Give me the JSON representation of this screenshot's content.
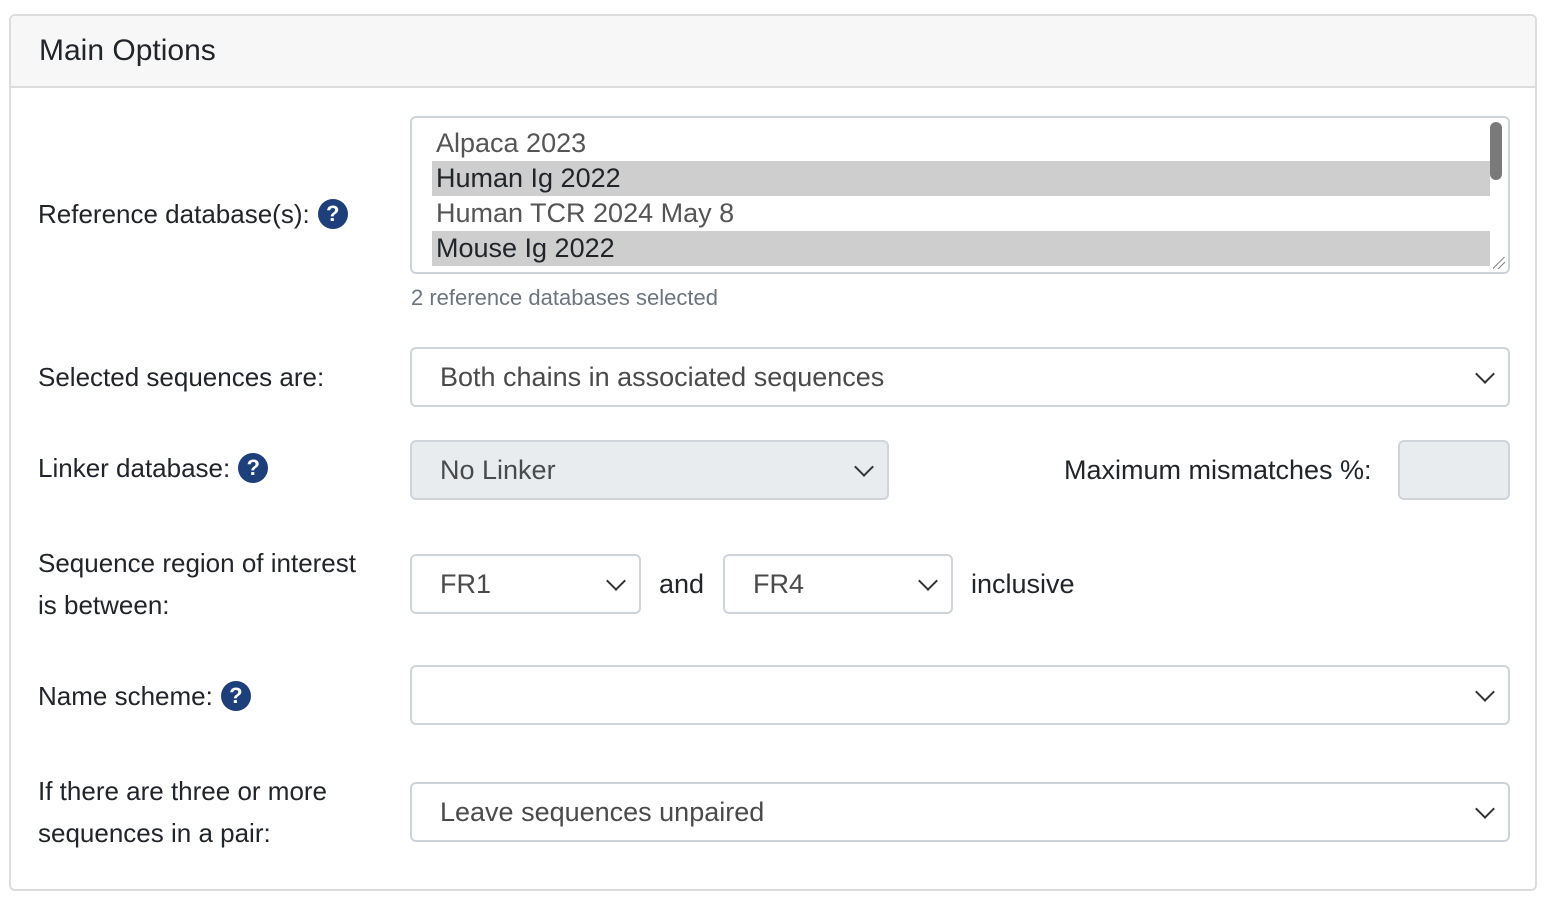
{
  "panel": {
    "title": "Main Options"
  },
  "reference": {
    "label": "Reference database(s):",
    "help": "?",
    "options": [
      {
        "label": "Alpaca 2023",
        "selected": false
      },
      {
        "label": "Human Ig 2022",
        "selected": true
      },
      {
        "label": "Human TCR 2024 May 8",
        "selected": false
      },
      {
        "label": "Mouse Ig 2022",
        "selected": true
      }
    ],
    "status": "2 reference databases selected"
  },
  "selected_sequences": {
    "label": "Selected sequences are:",
    "value": "Both chains in associated sequences"
  },
  "linker": {
    "label": "Linker database:",
    "help": "?",
    "value": "No Linker",
    "mismatch_label": "Maximum mismatches %:",
    "mismatch_value": ""
  },
  "region": {
    "label_line1": "Sequence region of interest",
    "label_line2": "is between:",
    "from": "FR1",
    "and_text": "and",
    "to": "FR4",
    "suffix": "inclusive"
  },
  "name_scheme": {
    "label": "Name scheme:",
    "help": "?",
    "value": ""
  },
  "multi": {
    "label_line1": "If there are three or more",
    "label_line2": "sequences in a pair:",
    "value": "Leave sequences unpaired"
  },
  "icons": {
    "help": "question-circle-icon",
    "dropdown": "chevron-down-icon"
  },
  "colors": {
    "help_icon": "#1d3f7a",
    "selected_option": "#cecece",
    "disabled_field": "#e9ecef"
  }
}
